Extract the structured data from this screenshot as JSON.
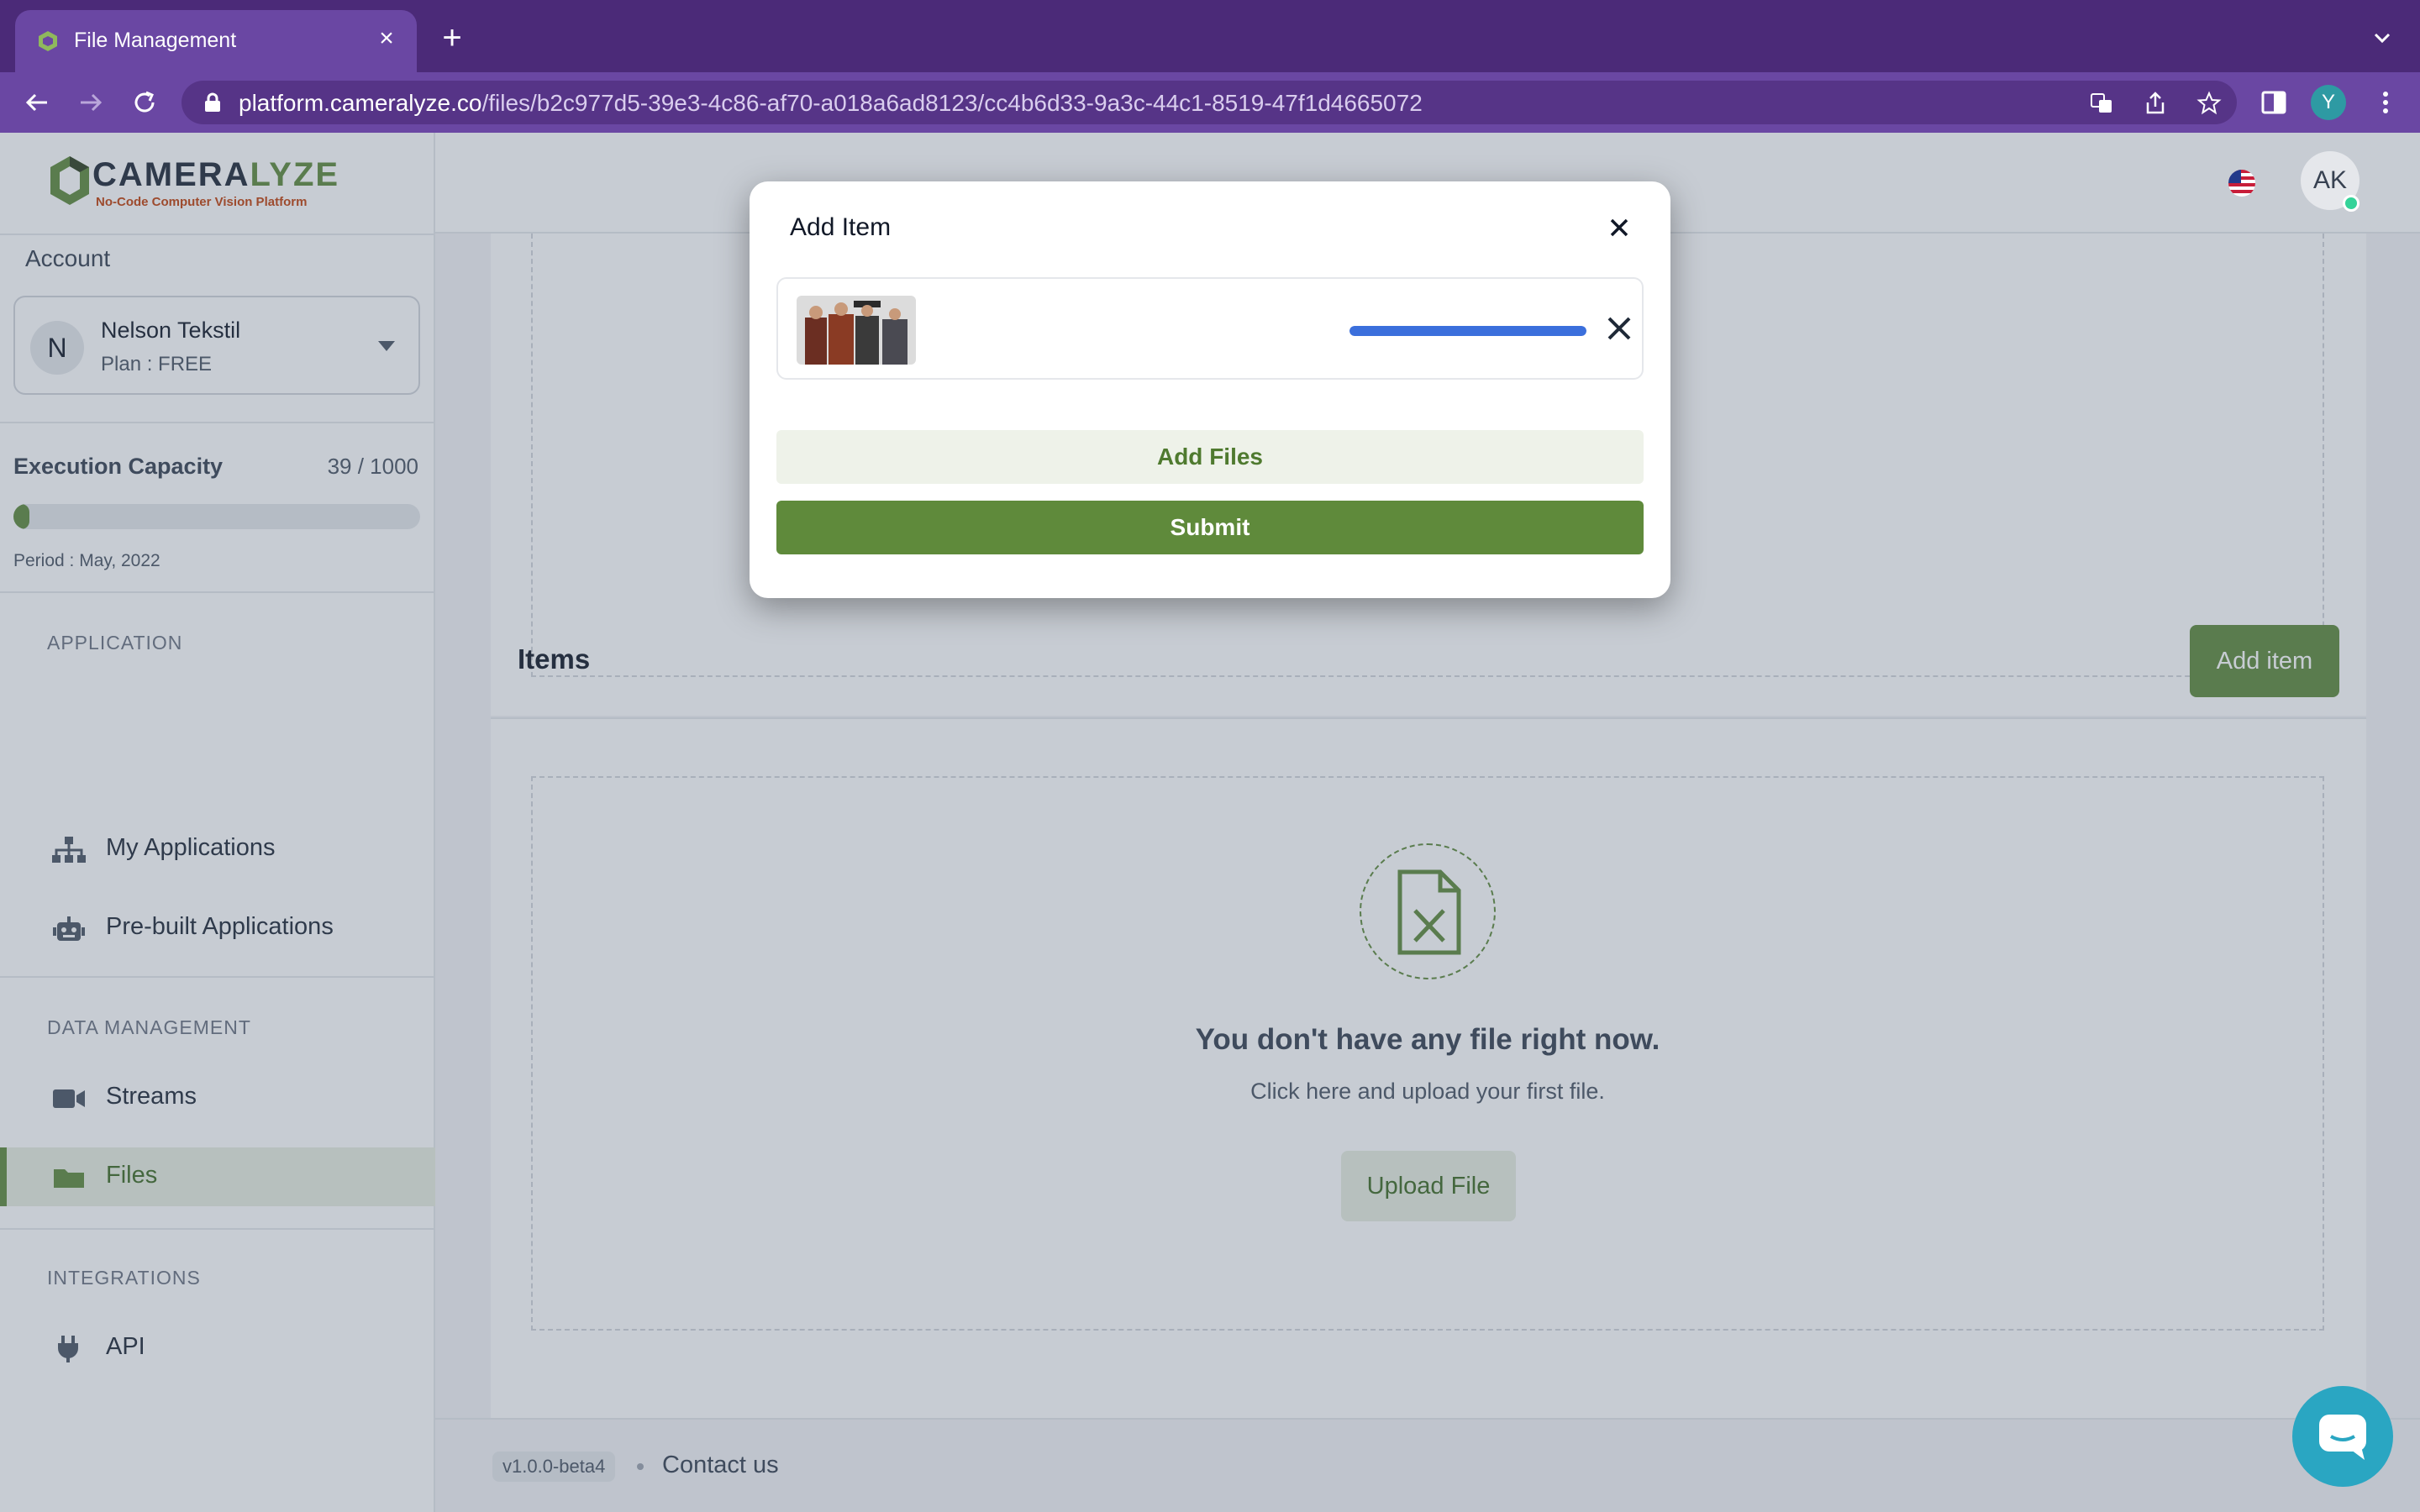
{
  "browser": {
    "tab_title": "File Management",
    "url_host": "platform.cameralyze.co",
    "url_path": "/files/b2c977d5-39e3-4c86-af70-a018a6ad8123/cc4b6d33-9a3c-44c1-8519-47f1d4665072",
    "profile_initial": "Y",
    "tab_close_glyph": "×",
    "new_tab_glyph": "+",
    "chrome_color": "#6a47a3"
  },
  "brand": {
    "name_prefix": "CAMERA",
    "name_suffix": "LYZE",
    "tagline": "No-Code Computer Vision Platform",
    "accent": "#5f8a3b"
  },
  "sidebar": {
    "account_label": "Account",
    "account": {
      "initial": "N",
      "name": "Nelson Tekstil",
      "plan": "Plan : FREE"
    },
    "capacity": {
      "label": "Execution Capacity",
      "value": "39 / 1000",
      "fraction": 0.039,
      "period": "Period : May, 2022"
    },
    "sections": [
      {
        "title": "APPLICATION",
        "items": [
          {
            "label": "My Applications",
            "icon": "sitemap-icon"
          },
          {
            "label": "Pre-built Applications",
            "icon": "robot-icon"
          }
        ]
      },
      {
        "title": "DATA MANAGEMENT",
        "items": [
          {
            "label": "Streams",
            "icon": "video-camera-icon"
          },
          {
            "label": "Files",
            "icon": "folder-icon",
            "active": true
          }
        ]
      },
      {
        "title": "INTEGRATIONS",
        "items": [
          {
            "label": "API",
            "icon": "plug-icon"
          }
        ]
      }
    ]
  },
  "header": {
    "user_initials": "AK",
    "language_icon": "us-flag-icon"
  },
  "main": {
    "items_title": "Items",
    "add_item_label": "Add item",
    "empty_title": "You don't have any file right now.",
    "empty_subtitle": "Click here and upload your first file.",
    "upload_label": "Upload File"
  },
  "footer": {
    "version": "v1.0.0-beta4",
    "contact": "Contact us"
  },
  "modal": {
    "title": "Add Item",
    "upload_progress": 1.0,
    "add_files_label": "Add Files",
    "submit_label": "Submit"
  }
}
